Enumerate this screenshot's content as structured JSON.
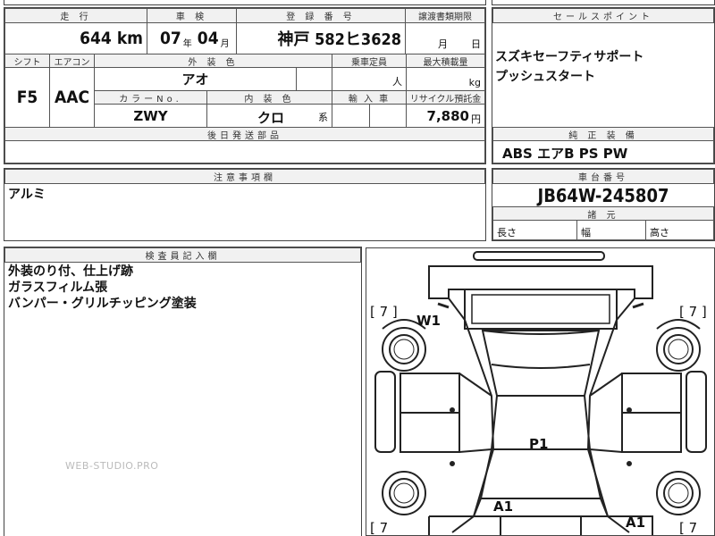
{
  "top_row": {
    "mileage_label": "走 行",
    "mileage_value": "644",
    "mileage_unit": "km",
    "inspection_label": "車 検",
    "inspection_year": "07",
    "inspection_year_unit": "年",
    "inspection_month": "04",
    "inspection_month_unit": "月",
    "registration_label": "登 録 番 号",
    "registration_value": "神戸 582ヒ3628",
    "transfer_label": "譲渡書類期限",
    "transfer_month_unit": "月",
    "transfer_day_unit": "日",
    "sales_point_label": "セールスポイント",
    "sales_points": [
      "スズキセーフティサポート",
      "プッシュスタート"
    ]
  },
  "spec_row": {
    "shift_label": "シフト",
    "shift_value": "F5",
    "aircon_label": "エアコン",
    "aircon_value": "AAC",
    "exterior_color_label": "外 装 色",
    "exterior_color_value": "アオ",
    "capacity_label": "乗車定員",
    "capacity_unit": "人",
    "max_load_label": "最大積載量",
    "max_load_unit": "kg",
    "color_no_label": "カラーNo.",
    "color_no_value": "ZWY",
    "interior_color_label": "内 装 色",
    "interior_color_value": "クロ",
    "interior_color_suffix": "系",
    "import_label": "輸 入 車",
    "recycle_label": "リサイクル預託金",
    "recycle_value": "7,880",
    "recycle_unit": "円"
  },
  "later_parts_label": "後日発送部品",
  "standard_equipment": {
    "label": "純 正 装 備",
    "value": "ABS エアB PS PW"
  },
  "notes": {
    "label": "注意事項欄",
    "value": "アルミ"
  },
  "chassis": {
    "label": "車台番号",
    "value": "JB64W-245807",
    "dimensions_label": "諸 元",
    "length_label": "長さ",
    "width_label": "幅",
    "height_label": "高さ"
  },
  "inspector": {
    "label": "検査員記入欄",
    "lines": [
      "外装のり付、仕上げ跡",
      "ガラスフィルム張",
      "バンパー・グリルチッピング塗装"
    ]
  },
  "watermark": "WEB-STUDIO.PRO",
  "diagram": {
    "marks": {
      "tl_bracket": "[ 7 ]",
      "tr_bracket": "[ 7 ]",
      "bl_bracket": "[ 7",
      "br_bracket": "[ 7",
      "w1": "W1",
      "p1": "P1",
      "a1_left": "A1",
      "a1_right": "A1"
    }
  }
}
